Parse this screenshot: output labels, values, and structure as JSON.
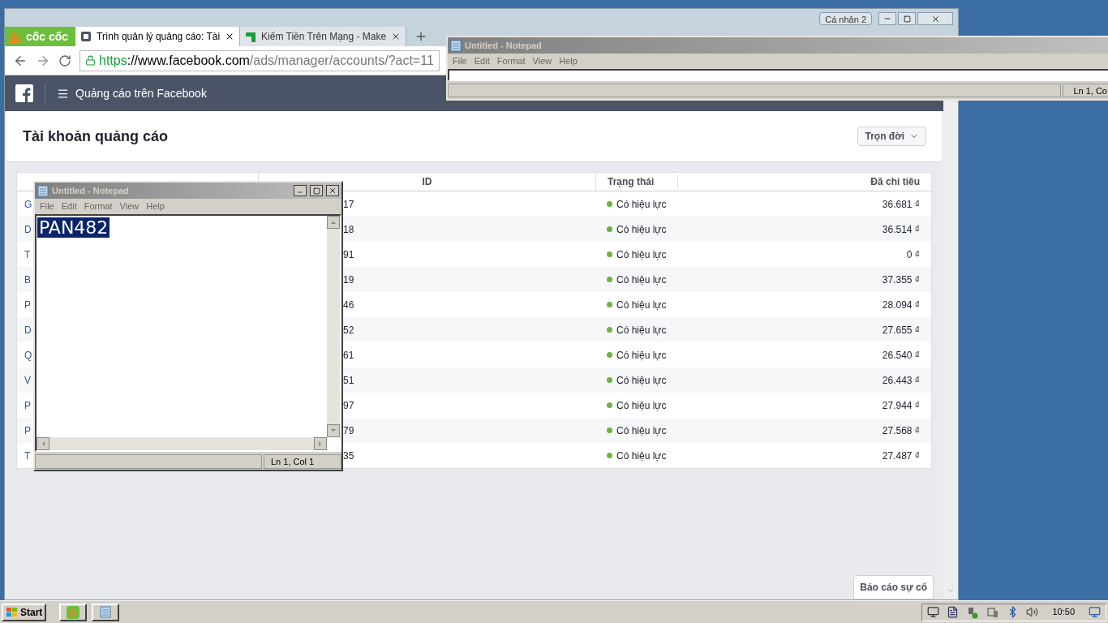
{
  "browser": {
    "profile_button": "Cá nhân 2",
    "brand": "cốc cốc",
    "tabs": [
      {
        "title": "Trình quản lý quảng cáo: Tài",
        "selected": true
      },
      {
        "title": "Kiếm Tiền Trên Mạng - Make",
        "selected": false
      }
    ],
    "url": {
      "scheme": "https",
      "host": "://www.facebook.com",
      "path": "/ads/manager/accounts/?act=11"
    },
    "app_bar": {
      "title": "Quảng cáo trên Facebook"
    },
    "page": {
      "title": "Tài khoản quảng cáo",
      "period_dropdown": "Trọn đời",
      "table": {
        "columns": [
          "ID",
          "Trạng thái",
          "Đã chi tiêu"
        ],
        "rows": [
          {
            "column_1": "G",
            "id": "17",
            "status": "Có hiệu lực",
            "spent": "36.681 ₫"
          },
          {
            "column_1": "D",
            "id": "18",
            "status": "Có hiệu lực",
            "spent": "36.514 ₫"
          },
          {
            "column_1": "T",
            "id": "91",
            "status": "Có hiệu lực",
            "spent": "0 ₫"
          },
          {
            "column_1": "B",
            "id": "19",
            "status": "Có hiệu lực",
            "spent": "37.355 ₫"
          },
          {
            "column_1": "P",
            "id": "46",
            "status": "Có hiệu lực",
            "spent": "28.094 ₫"
          },
          {
            "column_1": "D",
            "id": "52",
            "status": "Có hiệu lực",
            "spent": "27.655 ₫"
          },
          {
            "column_1": "Q",
            "id": "61",
            "status": "Có hiệu lực",
            "spent": "26.540 ₫"
          },
          {
            "column_1": "V",
            "id": "51",
            "status": "Có hiệu lực",
            "spent": "26.443 ₫"
          },
          {
            "column_1": "P",
            "id": "97",
            "status": "Có hiệu lực",
            "spent": "27.944 ₫"
          },
          {
            "column_1": "P",
            "id": "79",
            "status": "Có hiệu lực",
            "spent": "27.568 ₫"
          },
          {
            "column_1": "T",
            "id": "35",
            "status": "Có hiệu lực",
            "spent": "27.487 ₫"
          }
        ]
      },
      "report_button": "Báo cáo sự cố"
    }
  },
  "notepads": [
    {
      "title": "Untitled - Notepad",
      "menu": [
        "File",
        "Edit",
        "Format",
        "View",
        "Help"
      ],
      "status": "Ln 1, Co"
    },
    {
      "title": "Untitled - Notepad",
      "menu": [
        "File",
        "Edit",
        "Format",
        "View",
        "Help"
      ],
      "text": "PAN482",
      "text_selected": true,
      "status": "Ln 1, Col 1"
    }
  ],
  "taskbar": {
    "start": "Start",
    "clock": "10:50"
  }
}
